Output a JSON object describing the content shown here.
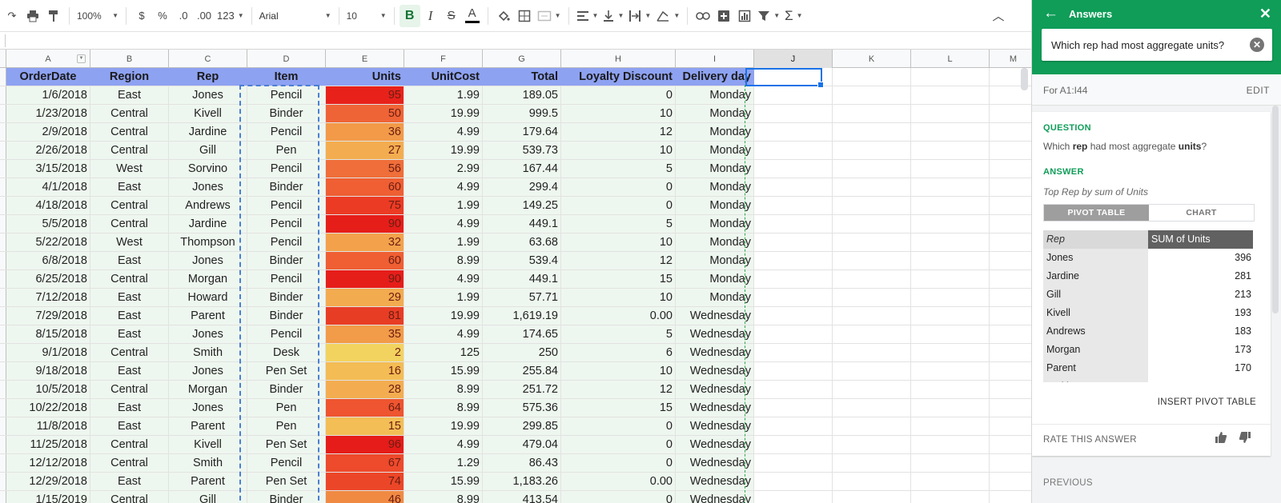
{
  "toolbar": {
    "zoom": "100%",
    "currency": "$",
    "percent": "%",
    "dec_less": ".0",
    "dec_more": ".00",
    "format": "123",
    "font": "Arial",
    "size": "10",
    "bold": "B",
    "italic": "I",
    "strike": "S",
    "text_color": "A",
    "sigma": "Σ"
  },
  "sheet": {
    "columns": [
      "A",
      "B",
      "C",
      "D",
      "E",
      "F",
      "G",
      "H",
      "I",
      "J",
      "K",
      "L",
      "M"
    ],
    "header": [
      "OrderDate",
      "Region",
      "Rep",
      "Item",
      "Units",
      "UnitCost",
      "Total",
      "Loyalty Discount",
      "Delivery day"
    ],
    "rows": [
      [
        "1/6/2018",
        "East",
        "Jones",
        "Pencil",
        "95",
        "1.99",
        "189.05",
        "0",
        "Monday"
      ],
      [
        "1/23/2018",
        "Central",
        "Kivell",
        "Binder",
        "50",
        "19.99",
        "999.5",
        "10",
        "Monday"
      ],
      [
        "2/9/2018",
        "Central",
        "Jardine",
        "Pencil",
        "36",
        "4.99",
        "179.64",
        "12",
        "Monday"
      ],
      [
        "2/26/2018",
        "Central",
        "Gill",
        "Pen",
        "27",
        "19.99",
        "539.73",
        "10",
        "Monday"
      ],
      [
        "3/15/2018",
        "West",
        "Sorvino",
        "Pencil",
        "56",
        "2.99",
        "167.44",
        "5",
        "Monday"
      ],
      [
        "4/1/2018",
        "East",
        "Jones",
        "Binder",
        "60",
        "4.99",
        "299.4",
        "0",
        "Monday"
      ],
      [
        "4/18/2018",
        "Central",
        "Andrews",
        "Pencil",
        "75",
        "1.99",
        "149.25",
        "0",
        "Monday"
      ],
      [
        "5/5/2018",
        "Central",
        "Jardine",
        "Pencil",
        "90",
        "4.99",
        "449.1",
        "5",
        "Monday"
      ],
      [
        "5/22/2018",
        "West",
        "Thompson",
        "Pencil",
        "32",
        "1.99",
        "63.68",
        "10",
        "Monday"
      ],
      [
        "6/8/2018",
        "East",
        "Jones",
        "Binder",
        "60",
        "8.99",
        "539.4",
        "12",
        "Monday"
      ],
      [
        "6/25/2018",
        "Central",
        "Morgan",
        "Pencil",
        "90",
        "4.99",
        "449.1",
        "15",
        "Monday"
      ],
      [
        "7/12/2018",
        "East",
        "Howard",
        "Binder",
        "29",
        "1.99",
        "57.71",
        "10",
        "Monday"
      ],
      [
        "7/29/2018",
        "East",
        "Parent",
        "Binder",
        "81",
        "19.99",
        "1,619.19",
        "0.00",
        "Wednesday"
      ],
      [
        "8/15/2018",
        "East",
        "Jones",
        "Pencil",
        "35",
        "4.99",
        "174.65",
        "5",
        "Wednesday"
      ],
      [
        "9/1/2018",
        "Central",
        "Smith",
        "Desk",
        "2",
        "125",
        "250",
        "6",
        "Wednesday"
      ],
      [
        "9/18/2018",
        "East",
        "Jones",
        "Pen Set",
        "16",
        "15.99",
        "255.84",
        "10",
        "Wednesday"
      ],
      [
        "10/5/2018",
        "Central",
        "Morgan",
        "Binder",
        "28",
        "8.99",
        "251.72",
        "12",
        "Wednesday"
      ],
      [
        "10/22/2018",
        "East",
        "Jones",
        "Pen",
        "64",
        "8.99",
        "575.36",
        "15",
        "Wednesday"
      ],
      [
        "11/8/2018",
        "East",
        "Parent",
        "Pen",
        "15",
        "19.99",
        "299.85",
        "0",
        "Wednesday"
      ],
      [
        "11/25/2018",
        "Central",
        "Kivell",
        "Pen Set",
        "96",
        "4.99",
        "479.04",
        "0",
        "Wednesday"
      ],
      [
        "12/12/2018",
        "Central",
        "Smith",
        "Pencil",
        "67",
        "1.29",
        "86.43",
        "0",
        "Wednesday"
      ],
      [
        "12/29/2018",
        "East",
        "Parent",
        "Pen Set",
        "74",
        "15.99",
        "1,183.26",
        "0.00",
        "Wednesday"
      ],
      [
        "1/15/2019",
        "Central",
        "Gill",
        "Binder",
        "46",
        "8.99",
        "413.54",
        "0",
        "Wednesday"
      ]
    ],
    "units_colors": [
      "#e8221b",
      "#ef6436",
      "#f29a48",
      "#f3ad50",
      "#ef6e39",
      "#ef5f33",
      "#ec3b24",
      "#e61e1a",
      "#f3a24b",
      "#ef5f33",
      "#e61e1a",
      "#f3ab4f",
      "#e83d25",
      "#f29b48",
      "#f3d35f",
      "#f3bc54",
      "#f3ad50",
      "#ee5530",
      "#f3be55",
      "#e51c19",
      "#ee4a2c",
      "#ec4628",
      "#f08a43"
    ],
    "header_color": "#8ea2f2",
    "cell_color": "#eef7ef"
  },
  "panel": {
    "title": "Answers",
    "query": "Which rep had most aggregate units?",
    "range": "For A1:I44",
    "edit": "EDIT",
    "question_label": "QUESTION",
    "q_pre": "Which ",
    "q_b1": "rep",
    "q_mid": " had most aggregate ",
    "q_b2": "units",
    "q_post": "?",
    "answer_label": "ANSWER",
    "subtitle": "Top Rep by sum of Units",
    "tab_pivot": "PIVOT TABLE",
    "tab_chart": "CHART",
    "pivot_head": [
      "Rep",
      "SUM of Units"
    ],
    "pivot_rows": [
      [
        "Jones",
        "396"
      ],
      [
        "Jardine",
        "281"
      ],
      [
        "Gill",
        "213"
      ],
      [
        "Kivell",
        "193"
      ],
      [
        "Andrews",
        "183"
      ],
      [
        "Morgan",
        "173"
      ],
      [
        "Parent",
        "170"
      ],
      [
        "Smith",
        ""
      ]
    ],
    "insert": "INSERT PIVOT TABLE",
    "rate": "RATE THIS ANSWER",
    "previous": "PREVIOUS",
    "accent": "#0f9d58"
  }
}
